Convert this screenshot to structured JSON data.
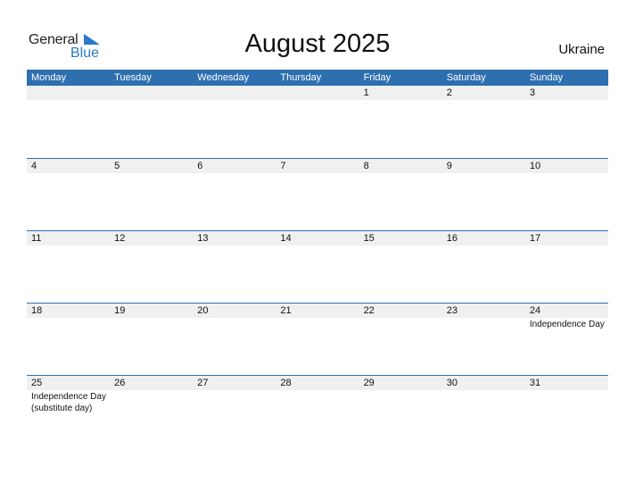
{
  "logo": {
    "word1": "General",
    "word2": "Blue"
  },
  "title": "August 2025",
  "country": "Ukraine",
  "colors": {
    "header_bg": "#2e6fb0",
    "date_band": "#f0f0f0",
    "logo_blue": "#2a7ac8"
  },
  "weekdays": [
    "Monday",
    "Tuesday",
    "Wednesday",
    "Thursday",
    "Friday",
    "Saturday",
    "Sunday"
  ],
  "weeks": [
    {
      "days": [
        {
          "num": "",
          "holiday": ""
        },
        {
          "num": "",
          "holiday": ""
        },
        {
          "num": "",
          "holiday": ""
        },
        {
          "num": "",
          "holiday": ""
        },
        {
          "num": "1",
          "holiday": ""
        },
        {
          "num": "2",
          "holiday": ""
        },
        {
          "num": "3",
          "holiday": ""
        }
      ]
    },
    {
      "days": [
        {
          "num": "4",
          "holiday": ""
        },
        {
          "num": "5",
          "holiday": ""
        },
        {
          "num": "6",
          "holiday": ""
        },
        {
          "num": "7",
          "holiday": ""
        },
        {
          "num": "8",
          "holiday": ""
        },
        {
          "num": "9",
          "holiday": ""
        },
        {
          "num": "10",
          "holiday": ""
        }
      ]
    },
    {
      "days": [
        {
          "num": "11",
          "holiday": ""
        },
        {
          "num": "12",
          "holiday": ""
        },
        {
          "num": "13",
          "holiday": ""
        },
        {
          "num": "14",
          "holiday": ""
        },
        {
          "num": "15",
          "holiday": ""
        },
        {
          "num": "16",
          "holiday": ""
        },
        {
          "num": "17",
          "holiday": ""
        }
      ]
    },
    {
      "days": [
        {
          "num": "18",
          "holiday": ""
        },
        {
          "num": "19",
          "holiday": ""
        },
        {
          "num": "20",
          "holiday": ""
        },
        {
          "num": "21",
          "holiday": ""
        },
        {
          "num": "22",
          "holiday": ""
        },
        {
          "num": "23",
          "holiday": ""
        },
        {
          "num": "24",
          "holiday": "Independence Day"
        }
      ]
    },
    {
      "days": [
        {
          "num": "25",
          "holiday": "Independence Day (substitute day)"
        },
        {
          "num": "26",
          "holiday": ""
        },
        {
          "num": "27",
          "holiday": ""
        },
        {
          "num": "28",
          "holiday": ""
        },
        {
          "num": "29",
          "holiday": ""
        },
        {
          "num": "30",
          "holiday": ""
        },
        {
          "num": "31",
          "holiday": ""
        }
      ]
    }
  ]
}
